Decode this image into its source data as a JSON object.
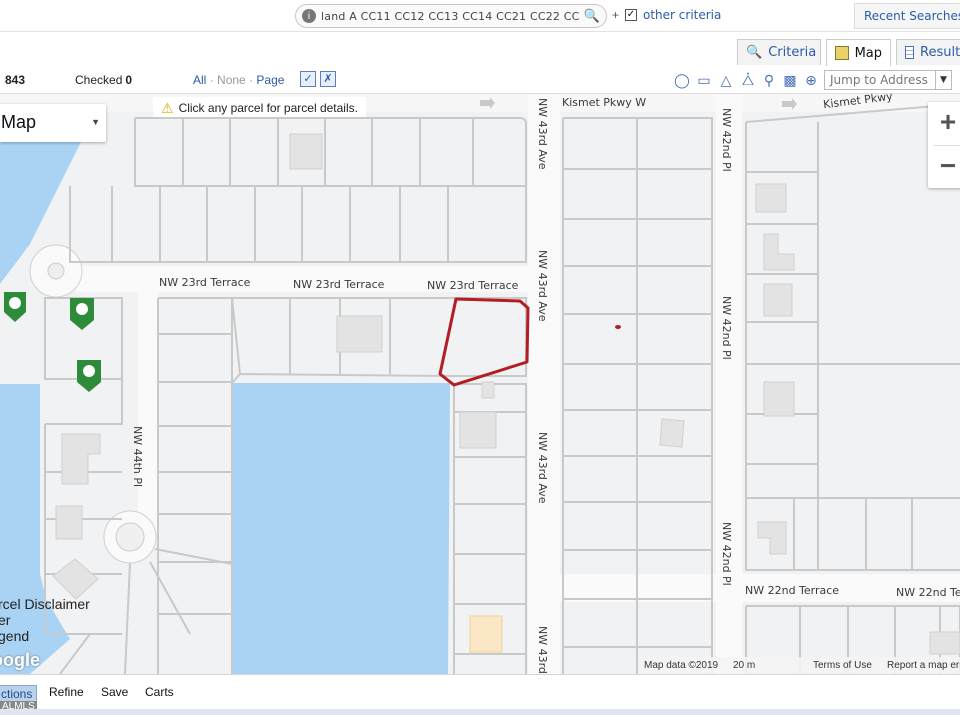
{
  "topbar": {
    "search_text": "land A CC11 CC12 CC13 CC14 CC21 CC22 CC",
    "info_icon": "info-icon",
    "plus": "+",
    "other_criteria_checked": true,
    "other_criteria_label": "other criteria",
    "recent_searches_label": "Recent Searches"
  },
  "tabs": [
    {
      "label": "Criteria",
      "icon": "magnifier-icon",
      "active": false
    },
    {
      "label": "Map",
      "icon": "map-icon",
      "active": true
    },
    {
      "label": "Results",
      "icon": "table-icon",
      "active": false
    }
  ],
  "toolbar": {
    "count": "843",
    "checked_label": "Checked",
    "checked_count": "0",
    "all": "All",
    "none": "None",
    "page": "Page",
    "sep": "·",
    "jump_placeholder": "Jump to Address"
  },
  "map": {
    "notice": "Click any parcel for parcel details.",
    "map_type": "Map",
    "zoom_in": "+",
    "zoom_out": "−",
    "roads": {
      "kismet_1": "Kismet Pkwy W",
      "kismet_2": "Kismet Pkwy",
      "terrace_1": "NW 23rd Terrace",
      "terrace_2": "NW 23rd Terrace",
      "terrace_3": "NW 23rd Terrace",
      "ave43_1": "NW 43rd Ave",
      "ave43_2": "NW 43rd Ave",
      "ave43_3": "NW 43rd Ave",
      "ave43_4": "NW 43rd",
      "pl42_1": "NW 42nd Pl",
      "pl42_2": "NW 42nd Pl",
      "pl42_3": "NW 42nd Pl",
      "pl44": "NW 44th Pl",
      "terrace22_1": "NW 22nd Terrace",
      "terrace22_2": "NW 22nd Te"
    },
    "legend_lines": [
      "rcel Disclaimer",
      "er",
      "gend"
    ],
    "google": "oogle",
    "attribution": {
      "map_data": "Map data ©2019",
      "scale": "20 m",
      "terms": "Terms of Use",
      "report": "Report a map error"
    },
    "colors": {
      "water": "#a9d3f5",
      "parcel_outline": "#b21e24",
      "road": "#ffffff",
      "lot_line": "#c9c9c9",
      "pin": "#2e8b3a"
    }
  },
  "bottom_nav": {
    "actions": "ctions",
    "refine": "Refine",
    "save": "Save",
    "carts": "Carts",
    "mls": "ALMLS"
  }
}
